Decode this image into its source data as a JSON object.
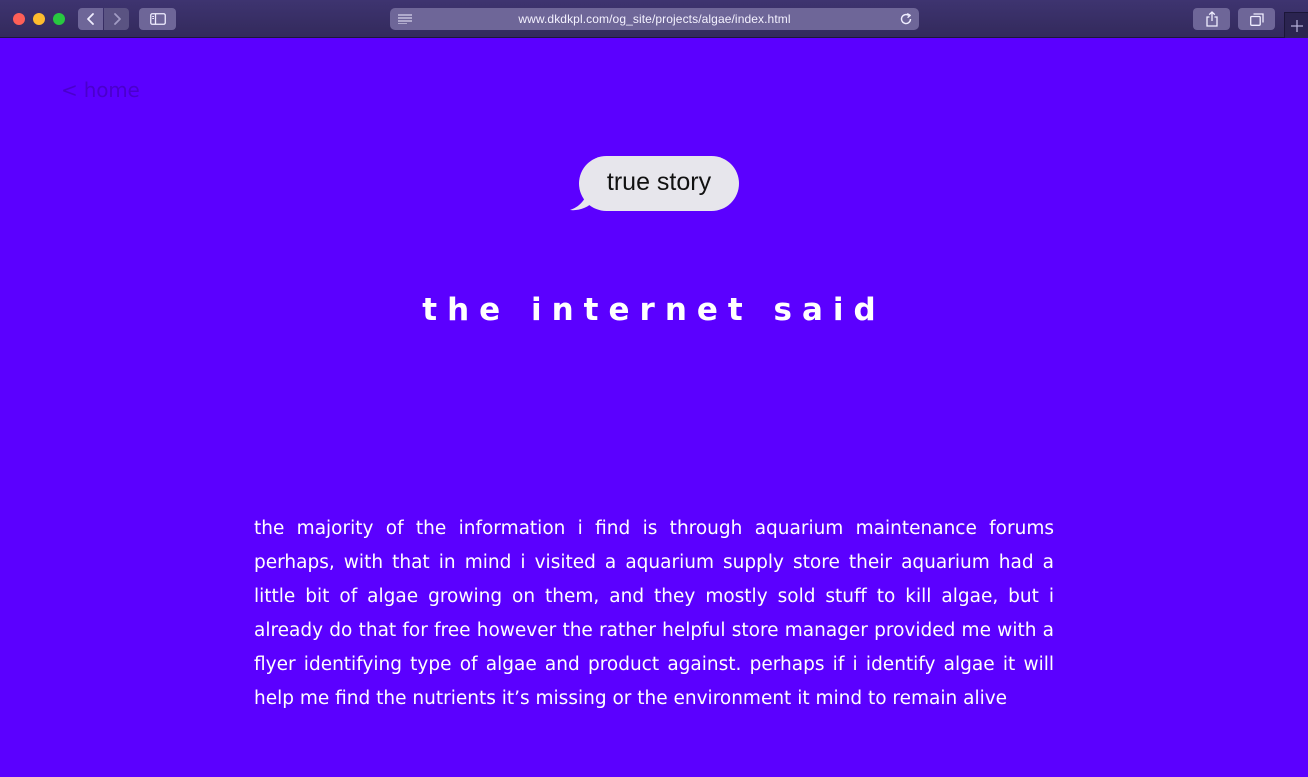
{
  "browser": {
    "url": "www.dkdkpl.com/og_site/projects/algae/index.html",
    "icons": {
      "back": "chevron-left-icon",
      "forward": "chevron-right-icon",
      "sidebar": "sidebar-icon",
      "reader": "reader-lines-icon",
      "reload": "reload-icon",
      "share": "share-icon",
      "tabs": "tab-overview-icon",
      "new_tab": "plus-icon"
    }
  },
  "page": {
    "home_link": "< home",
    "bubble": "true story",
    "headline": "the internet said",
    "body": "the majority of the information i find is through aquarium maintenance forums perhaps, with that in mind i visited a aquarium supply store their aquarium had a little bit of algae growing on them, and they mostly sold stuff to kill algae, but i already do that for free however the rather helpful store manager provided me with a flyer identifying type of algae and product against. perhaps if i identify algae it will help me find the nutrients it’s missing or the environment it mind to remain alive"
  },
  "colors": {
    "page_background": "#5b00ff",
    "home_link": "#4a00cc",
    "bubble": "#e7e6ec",
    "text": "#ffffff"
  }
}
